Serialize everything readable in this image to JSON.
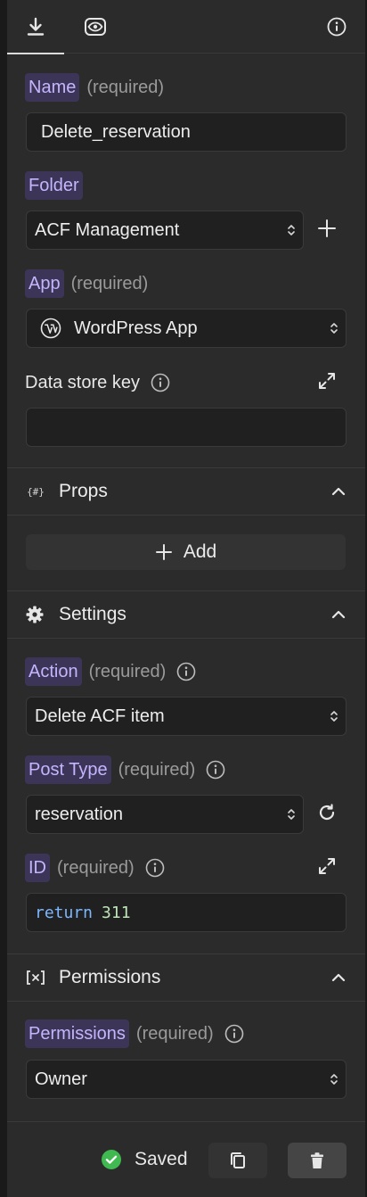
{
  "tabs": [
    {
      "icon": "download-icon",
      "active": true
    },
    {
      "icon": "eye-icon",
      "active": false
    },
    {
      "icon": "info-icon",
      "active": false
    }
  ],
  "fields": {
    "name": {
      "label": "Name",
      "required_text": "(required)",
      "value": "Delete_reservation"
    },
    "folder": {
      "label": "Folder",
      "value": "ACF Management"
    },
    "app": {
      "label": "App",
      "required_text": "(required)",
      "value": "WordPress App",
      "icon": "wordpress-icon"
    },
    "data_store_key": {
      "label": "Data store key",
      "value": ""
    }
  },
  "sections": {
    "props": {
      "title": "Props",
      "icon": "braces-hash-icon",
      "add_label": "Add"
    },
    "settings": {
      "title": "Settings",
      "icon": "gear-icon"
    },
    "permissions": {
      "title": "Permissions",
      "icon": "bracket-x-icon"
    }
  },
  "settings": {
    "action": {
      "label": "Action",
      "required_text": "(required)",
      "value": "Delete ACF item"
    },
    "post_type": {
      "label": "Post Type",
      "required_text": "(required)",
      "value": "reservation"
    },
    "id": {
      "label": "ID",
      "required_text": "(required)",
      "code_keyword": "return",
      "code_value": "311"
    }
  },
  "permissions": {
    "label": "Permissions",
    "required_text": "(required)",
    "value": "Owner"
  },
  "footer": {
    "status": "Saved",
    "status_color": "#3fb950"
  },
  "colors": {
    "chip_bg": "#3d3557",
    "chip_text": "#c4b5fd",
    "panel_bg": "#2b2b2b"
  }
}
